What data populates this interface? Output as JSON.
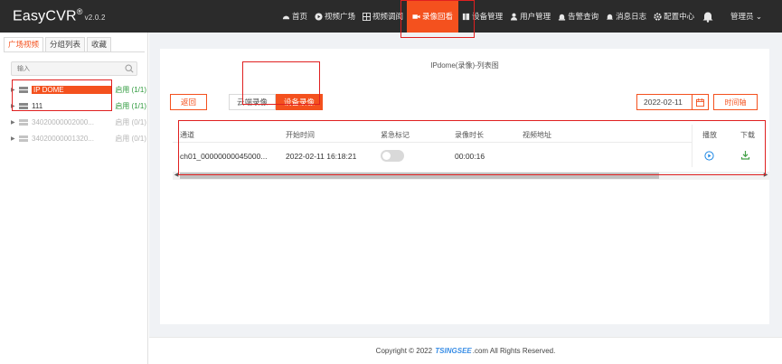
{
  "app": {
    "logo": "EasyCVR",
    "reg": "®",
    "version": "v2.0.2"
  },
  "nav": [
    {
      "label": "首页",
      "icon": "dashboard-icon"
    },
    {
      "label": "视频广场",
      "icon": "play-circle-icon"
    },
    {
      "label": "视频调阅",
      "icon": "grid-icon"
    },
    {
      "label": "录像回看",
      "icon": "video-camera-icon",
      "active": true
    },
    {
      "label": "设备管理",
      "icon": "device-icon"
    },
    {
      "label": "用户管理",
      "icon": "user-icon"
    },
    {
      "label": "告警查询",
      "icon": "alarm-icon"
    },
    {
      "label": "消息日志",
      "icon": "bell-icon"
    },
    {
      "label": "配置中心",
      "icon": "gear-icon"
    }
  ],
  "user": {
    "name": "管理员 ⌄"
  },
  "left": {
    "tabs": [
      "广场视频",
      "分组列表",
      "收藏"
    ],
    "search_placeholder": "输入",
    "tree": [
      {
        "name": "IP DOME",
        "status": "启用",
        "count": "(1/1)",
        "online": true,
        "selected": true
      },
      {
        "name": "111",
        "status": "启用",
        "count": "(1/1)",
        "online": true
      },
      {
        "name": "34020000002000...",
        "status": "启用",
        "count": "(0/1)",
        "online": false
      },
      {
        "name": "34020000001320...",
        "status": "启用",
        "count": "(0/1)",
        "online": false
      }
    ]
  },
  "main": {
    "title": "IPdome(录像)-列表图",
    "back_label": "返回",
    "segments": [
      "云端录像",
      "设备录像"
    ],
    "date": "2022-02-11",
    "timeline_label": "时间轴",
    "columns": [
      "通道",
      "开始时间",
      "紧急标记",
      "录像时长",
      "视频地址",
      "播放",
      "下载"
    ],
    "rows": [
      {
        "channel": "ch01_00000000045000...",
        "start": "2022-02-11 16:18:21",
        "duration": "00:00:16",
        "url": ""
      }
    ]
  },
  "footer": {
    "prefix": "Copyright © 2022",
    "brand": "TSINGSEE",
    "suffix": ".com All Rights Reserved."
  },
  "colors": {
    "accent": "#f4511e",
    "topbar": "#2b2b2b",
    "online": "#2e9a3c",
    "highlight": "#e02020"
  }
}
